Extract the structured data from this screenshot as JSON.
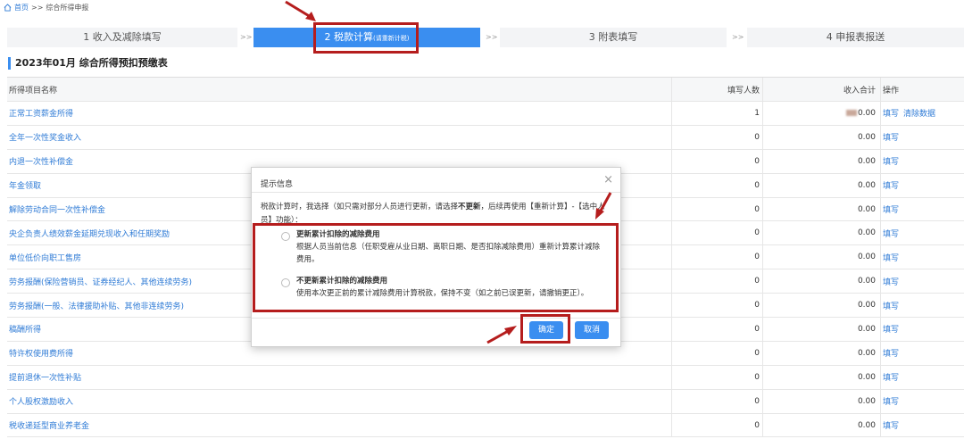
{
  "breadcrumb": {
    "home": "首页",
    "separator": ">>",
    "current": "综合所得申报"
  },
  "steps": [
    {
      "label": "1 收入及减除填写",
      "sub": "",
      "active": false
    },
    {
      "label": "2 税款计算",
      "sub": "(请重新计税)",
      "active": true
    },
    {
      "label": "3 附表填写",
      "sub": "",
      "active": false
    },
    {
      "label": "4 申报表报送",
      "sub": "",
      "active": false
    }
  ],
  "step_sep": ">>",
  "section_title": "2023年01月  综合所得预扣预缴表",
  "table": {
    "headers": {
      "name": "所得项目名称",
      "count": "填写人数",
      "income": "收入合计",
      "action": "操作"
    },
    "rows": [
      {
        "name": "正常工资薪金所得",
        "count": "1",
        "income": "0.00",
        "actions": [
          "填写",
          "清除数据"
        ]
      },
      {
        "name": "全年一次性奖金收入",
        "count": "0",
        "income": "0.00",
        "actions": [
          "填写"
        ]
      },
      {
        "name": "内退一次性补偿金",
        "count": "0",
        "income": "0.00",
        "actions": [
          "填写"
        ]
      },
      {
        "name": "年金领取",
        "count": "0",
        "income": "0.00",
        "actions": [
          "填写"
        ]
      },
      {
        "name": "解除劳动合同一次性补偿金",
        "count": "0",
        "income": "0.00",
        "actions": [
          "填写"
        ]
      },
      {
        "name": "央企负责人绩效薪金延期兑现收入和任期奖励",
        "count": "0",
        "income": "0.00",
        "actions": [
          "填写"
        ]
      },
      {
        "name": "单位低价向职工售房",
        "count": "0",
        "income": "0.00",
        "actions": [
          "填写"
        ]
      },
      {
        "name": "劳务报酬(保险营销员、证券经纪人、其他连续劳务)",
        "count": "0",
        "income": "0.00",
        "actions": [
          "填写"
        ]
      },
      {
        "name": "劳务报酬(一般、法律援助补贴、其他非连续劳务)",
        "count": "0",
        "income": "0.00",
        "actions": [
          "填写"
        ]
      },
      {
        "name": "稿酬所得",
        "count": "0",
        "income": "0.00",
        "actions": [
          "填写"
        ]
      },
      {
        "name": "特许权使用费所得",
        "count": "0",
        "income": "0.00",
        "actions": [
          "填写"
        ]
      },
      {
        "name": "提前退休一次性补贴",
        "count": "0",
        "income": "0.00",
        "actions": [
          "填写"
        ]
      },
      {
        "name": "个人股权激励收入",
        "count": "0",
        "income": "0.00",
        "actions": [
          "填写"
        ]
      },
      {
        "name": "税收递延型商业养老金",
        "count": "0",
        "income": "0.00",
        "actions": [
          "填写"
        ]
      }
    ]
  },
  "modal": {
    "title": "提示信息",
    "close": "×",
    "desc_prefix": "税款计算时，我选择（如只需对部分人员进行更新，请选择",
    "desc_bold": "不更新",
    "desc_suffix": "，后续再使用【重新计算】-【选中人员】功能）：",
    "option1_title": "更新累计扣除的减除费用",
    "option1_desc": "根据人员当前信息（任职受雇从业日期、离职日期、是否扣除减除费用）重新计算累计减除费用。",
    "option2_title": "不更新累计扣除的减除费用",
    "option2_desc": "使用本次更正前的累计减除费用计算税款，保持不变（如之前已误更新，请撤销更正）。",
    "confirm": "确定",
    "cancel": "取消"
  },
  "colors": {
    "accent": "#3a8ef0",
    "link": "#2f7bd6",
    "highlight": "#b51d1d"
  }
}
